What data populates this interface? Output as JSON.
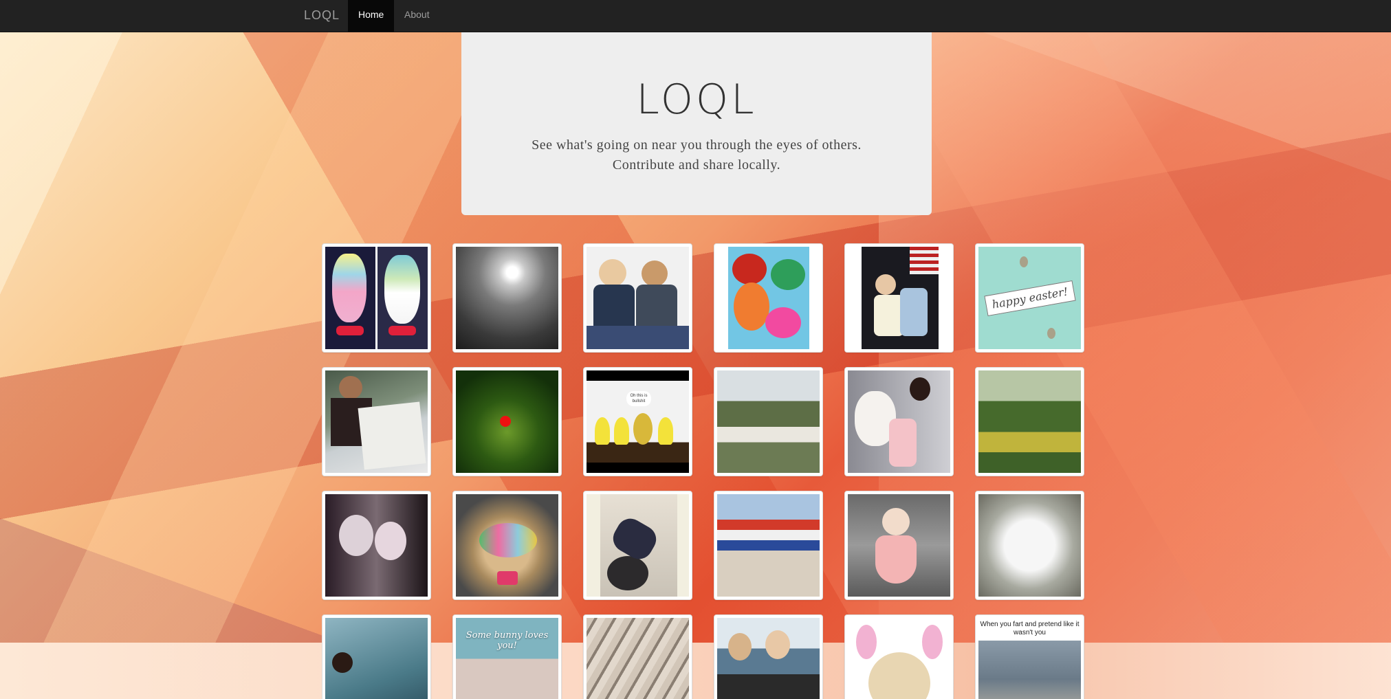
{
  "nav": {
    "brand": "LOQL",
    "items": [
      {
        "label": "Home",
        "active": true
      },
      {
        "label": "About",
        "active": false
      }
    ]
  },
  "hero": {
    "title": "LOQL",
    "tagline_line1": "See what's going on near you through the eyes of others.",
    "tagline_line2": "Contribute and share locally."
  },
  "photo_captions": {
    "mugshot": "Oh this is bullshit",
    "bunny": "Some bunny loves you!",
    "easter": "happy easter!",
    "fart": "When you fart and pretend like it wasn't you"
  },
  "photos": [
    {
      "subject": "plush egg toys"
    },
    {
      "subject": "cloudy sky over city"
    },
    {
      "subject": "two women posing"
    },
    {
      "subject": "glitter eggs"
    },
    {
      "subject": "two women by flag"
    },
    {
      "subject": "happy easter card"
    },
    {
      "subject": "man reading WSJ"
    },
    {
      "subject": "tropical plants"
    },
    {
      "subject": "peeps lineup"
    },
    {
      "subject": "tree and house"
    },
    {
      "subject": "woman with bunny"
    },
    {
      "subject": "garden flowers"
    },
    {
      "subject": "two friends selfie"
    },
    {
      "subject": "easter basket"
    },
    {
      "subject": "woman on ball"
    },
    {
      "subject": "group by mural"
    },
    {
      "subject": "toddler in chair"
    },
    {
      "subject": "decorated glove"
    },
    {
      "subject": "child by water"
    },
    {
      "subject": "some bunny loves you"
    },
    {
      "subject": "architecture lines"
    },
    {
      "subject": "two women by sea"
    },
    {
      "subject": "dog with bunny ears"
    },
    {
      "subject": "dogs in car meme"
    }
  ]
}
